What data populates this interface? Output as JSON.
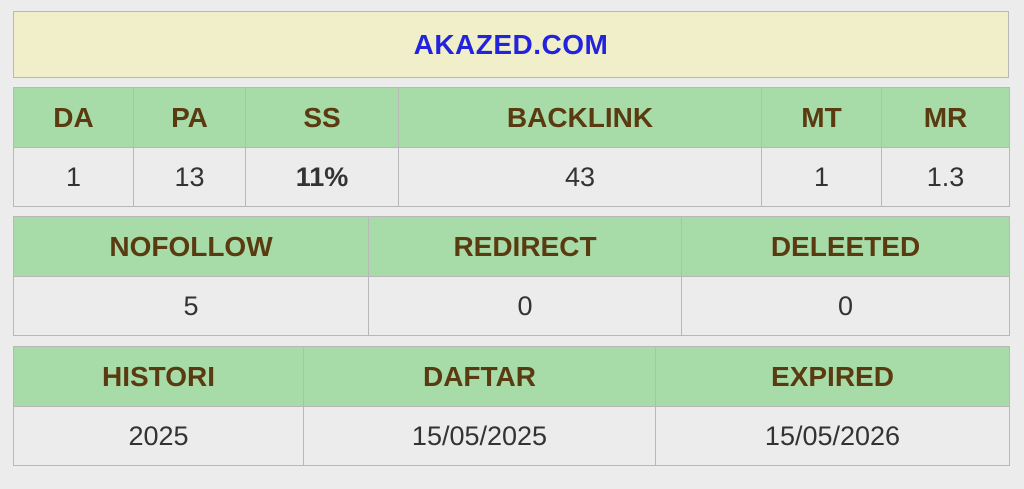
{
  "domain": "AKAZED.COM",
  "colors": {
    "domain_text": "#2323dd",
    "domain_bg": "#f0efc9",
    "header_bg": "#a7dba7",
    "header_text": "#5a3a10",
    "ss_value": "#22c3c3"
  },
  "metrics": {
    "da": {
      "label": "DA",
      "value": "1"
    },
    "pa": {
      "label": "PA",
      "value": "13"
    },
    "ss": {
      "label": "SS",
      "value": "11%"
    },
    "backlink": {
      "label": "BACKLINK",
      "value": "43"
    },
    "mt": {
      "label": "MT",
      "value": "1"
    },
    "mr": {
      "label": "MR",
      "value": "1.3"
    }
  },
  "links": {
    "nofollow": {
      "label": "NOFOLLOW",
      "value": "5"
    },
    "redirect": {
      "label": "REDIRECT",
      "value": "0"
    },
    "deleeted": {
      "label": "DELEETED",
      "value": "0"
    }
  },
  "dates": {
    "histori": {
      "label": "HISTORI",
      "value": "2025"
    },
    "daftar": {
      "label": "DAFTAR",
      "value": "15/05/2025"
    },
    "expired": {
      "label": "EXPIRED",
      "value": "15/05/2026"
    }
  }
}
